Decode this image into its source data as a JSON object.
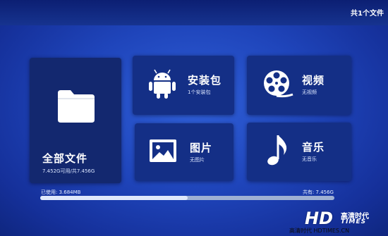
{
  "header": {
    "count": "共1个文件"
  },
  "tiles": [
    {
      "id": "all",
      "title": "全部文件",
      "subtitle": "7.452G可用/共7.456G",
      "icon": "folder-icon"
    },
    {
      "id": "apk",
      "title": "安装包",
      "subtitle": "1个安装包",
      "icon": "android-icon"
    },
    {
      "id": "video",
      "title": "视频",
      "subtitle": "无视频",
      "icon": "film-reel-icon"
    },
    {
      "id": "pictures",
      "title": "图片",
      "subtitle": "无图片",
      "icon": "picture-icon"
    },
    {
      "id": "music",
      "title": "音乐",
      "subtitle": "无音乐",
      "icon": "music-note-icon"
    }
  ],
  "storage": {
    "used_label": "已使用: 3.684MB",
    "total_label": "共有: 7.456G",
    "used_fraction": 0.5
  },
  "watermark": {
    "hd": "HD",
    "cn": "高清时代",
    "times": "TIMES",
    "url": "高清时代 HDTIMES.CN"
  },
  "colors": {
    "background": "#1f45bb",
    "tile": "#142f86",
    "accent": "#ffffff"
  }
}
